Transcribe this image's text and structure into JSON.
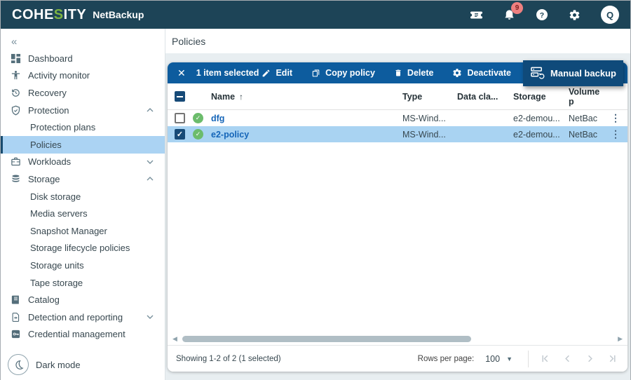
{
  "topbar": {
    "brand_part1": "COHE",
    "brand_s": "S",
    "brand_part2": "ITY",
    "product": "NetBackup",
    "notification_count": "9",
    "avatar_initial": "Q"
  },
  "sidebar": {
    "collapse_icon": "«",
    "items": [
      {
        "label": "Dashboard",
        "icon": "dashboard-icon",
        "level": 0
      },
      {
        "label": "Activity monitor",
        "icon": "activity-monitor-icon",
        "level": 0
      },
      {
        "label": "Recovery",
        "icon": "recovery-icon",
        "level": 0
      },
      {
        "label": "Protection",
        "icon": "protection-icon",
        "level": 0,
        "expanded": true
      },
      {
        "label": "Protection plans",
        "level": 1
      },
      {
        "label": "Policies",
        "level": 1,
        "selected": true
      },
      {
        "label": "Workloads",
        "icon": "workloads-icon",
        "level": 0,
        "expanded": false
      },
      {
        "label": "Storage",
        "icon": "storage-icon",
        "level": 0,
        "expanded": true
      },
      {
        "label": "Disk storage",
        "level": 1
      },
      {
        "label": "Media servers",
        "level": 1
      },
      {
        "label": "Snapshot Manager",
        "level": 1
      },
      {
        "label": "Storage lifecycle policies",
        "level": 1
      },
      {
        "label": "Storage units",
        "level": 1
      },
      {
        "label": "Tape storage",
        "level": 1
      },
      {
        "label": "Catalog",
        "icon": "catalog-icon",
        "level": 0
      },
      {
        "label": "Detection and reporting",
        "icon": "detection-reporting-icon",
        "level": 0,
        "expanded": false
      },
      {
        "label": "Credential management",
        "icon": "credential-management-icon",
        "level": 0
      }
    ],
    "dark_mode_label": "Dark mode"
  },
  "page": {
    "title": "Policies"
  },
  "selection_toolbar": {
    "selected_text": "1 item selected",
    "close_icon": "✕",
    "actions": [
      {
        "label": "Edit",
        "icon": "edit-icon"
      },
      {
        "label": "Copy policy",
        "icon": "copy-icon"
      },
      {
        "label": "Delete",
        "icon": "delete-icon"
      },
      {
        "label": "Deactivate",
        "icon": "deactivate-icon"
      }
    ],
    "primary_action": {
      "label": "Manual backup",
      "icon": "manual-backup-icon"
    }
  },
  "table": {
    "columns": [
      "Name",
      "Type",
      "Data cla...",
      "Storage",
      "Volume p"
    ],
    "sort": {
      "column": "Name",
      "direction": "asc",
      "arrow": "↑"
    },
    "rows": [
      {
        "selected": false,
        "checked": false,
        "status": "ok",
        "name": "dfg",
        "type": "MS-Wind...",
        "data_classification": "",
        "storage": "e2-demou...",
        "volume_pool": "NetBac"
      },
      {
        "selected": true,
        "checked": true,
        "status": "ok",
        "name": "e2-policy",
        "type": "MS-Wind...",
        "data_classification": "",
        "storage": "e2-demou...",
        "volume_pool": "NetBac"
      }
    ]
  },
  "footer": {
    "showing_text": "Showing 1-2 of 2 (1 selected)",
    "rows_per_page_label": "Rows per page:",
    "rows_per_page_value": "100"
  },
  "colors": {
    "topbar_bg": "#1d4457",
    "brand_green": "#7cb342",
    "toolbar_bg": "#0d5c9e",
    "primary_button_bg": "#0f4a7a",
    "selected_row_bg": "#a9d3f2",
    "sidebar_selected_bg": "#abd3f3",
    "link_blue": "#1565b8",
    "status_green": "#6cbc6c",
    "badge_bg": "#ee8080"
  }
}
